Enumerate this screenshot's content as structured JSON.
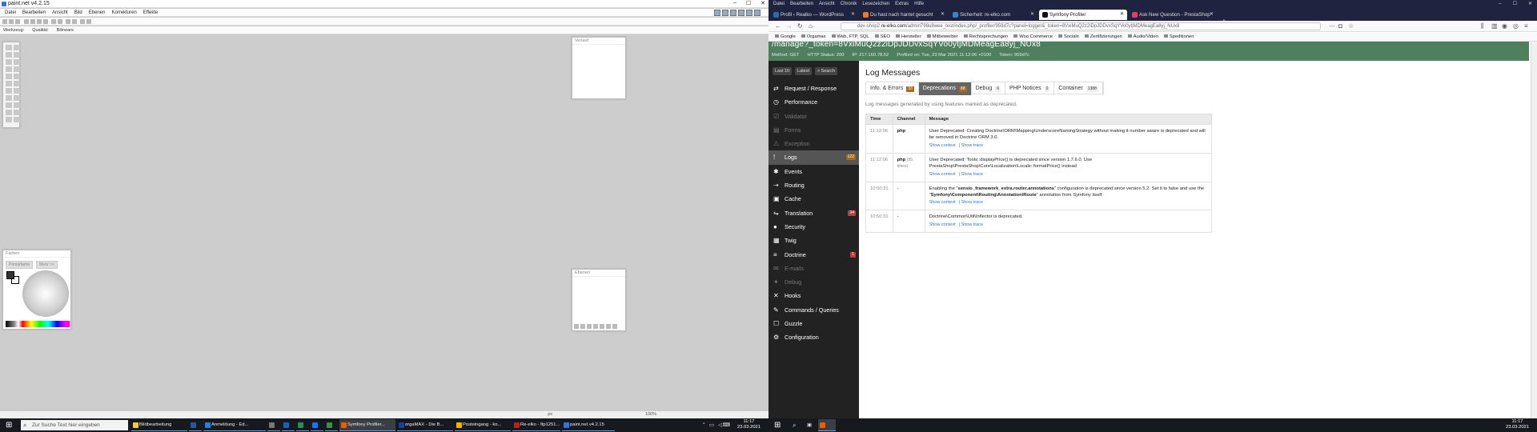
{
  "paintnet": {
    "title": "paint.net v4.2.15",
    "menu": [
      "Datei",
      "Bearbeiten",
      "Ansicht",
      "Bild",
      "Ebenen",
      "Korrekturen",
      "Effekte"
    ],
    "toolbar2": {
      "tool_label": "Werkzeug:",
      "quality_label": "Qualität:",
      "quality_value": "Bilineare"
    },
    "history_title": "Verlauf",
    "layers_title": "Ebenen",
    "colors_title": "Farben",
    "colors_primary": "Primärfarbe",
    "colors_more": "Mehr >>",
    "zoom": "100%",
    "unit": "px"
  },
  "firefox": {
    "menu": [
      "Datei",
      "Bearbeiten",
      "Ansicht",
      "Chronik",
      "Lesezeichen",
      "Extras",
      "Hilfe"
    ],
    "tabs": [
      {
        "label": "Profil ‹ Realko — WordPress",
        "color": "#2b6ca3"
      },
      {
        "label": "Du hast nach hantel gesucht",
        "color": "#e07b3a"
      },
      {
        "label": "Sicherheit: re-elko.com",
        "color": "#3b82c4"
      },
      {
        "label": "Symfony Profiler",
        "color": "#111111"
      },
      {
        "label": "Ask New Question - PrestaShop",
        "color": "#df3f6b"
      }
    ],
    "url_prefix": "dev-shop2.",
    "url_domain": "re-elko.com",
    "url_rest": "/admin798u8wee_test/index.php/_profiler/959d7c?panel=logger&_token=8VxiMuQ2z2iDpJDDvxSqYVo0ytjMDMeagEa8yj_NUx8",
    "bookmarks": [
      "Google",
      "Orgamax",
      "Web, FTP, SQL",
      "SEO",
      "Hersteller",
      "Mitbewerber",
      "Rechtsprechungen",
      "Woo Commerce",
      "Socials",
      "Zertifizierungen",
      "Audio/Video",
      "Speditionen"
    ]
  },
  "profiler": {
    "token_url": "/manage?_token=8VxiMuQ2z2iDpJDDvxSqYVo0ytjMDMeagEa8yj_NUx8",
    "meta": [
      "Method: GET",
      "HTTP Status: 200",
      "IP: 217.160.78.52",
      "Profiled on: Tue, 23 Mar 2021 11:12:06 +0100",
      "Token: 959d7c"
    ],
    "search_buttons": [
      "Last 10",
      "Latest",
      "Search"
    ],
    "sidebar": [
      {
        "label": "Request / Response",
        "icon": "⇄",
        "state": "normal"
      },
      {
        "label": "Performance",
        "icon": "◷",
        "state": "normal"
      },
      {
        "label": "Validator",
        "icon": "☑",
        "state": "dim"
      },
      {
        "label": "Forms",
        "icon": "▤",
        "state": "dim"
      },
      {
        "label": "Exception",
        "icon": "⚠",
        "state": "dim"
      },
      {
        "label": "Logs",
        "icon": "!",
        "state": "active",
        "count": "122",
        "count_color": "y"
      },
      {
        "label": "Events",
        "icon": "✱",
        "state": "normal"
      },
      {
        "label": "Routing",
        "icon": "⇢",
        "state": "normal"
      },
      {
        "label": "Cache",
        "icon": "▣",
        "state": "normal"
      },
      {
        "label": "Translation",
        "icon": "⇋",
        "state": "normal",
        "count": "34",
        "count_color": "r"
      },
      {
        "label": "Security",
        "icon": "●",
        "state": "normal"
      },
      {
        "label": "Twig",
        "icon": "▦",
        "state": "normal"
      },
      {
        "label": "Doctrine",
        "icon": "≡",
        "state": "normal",
        "count": "1",
        "count_color": "r"
      },
      {
        "label": "E-mails",
        "icon": "✉",
        "state": "dim"
      },
      {
        "label": "Debug",
        "icon": "✦",
        "state": "dim"
      },
      {
        "label": "Hooks",
        "icon": "✕",
        "state": "normal"
      },
      {
        "label": "Commands / Queries",
        "icon": "✎",
        "state": "normal"
      },
      {
        "label": "Guzzle",
        "icon": "☐",
        "state": "normal"
      },
      {
        "label": "Configuration",
        "icon": "⚙",
        "state": "normal"
      }
    ],
    "heading": "Log Messages",
    "tabs": [
      {
        "label": "Info. & Errors",
        "count": "33",
        "style": "y"
      },
      {
        "label": "Deprecations",
        "count": "88",
        "style": "active"
      },
      {
        "label": "Debug",
        "count": "6",
        "style": ""
      },
      {
        "label": "PHP Notices",
        "count": "0",
        "style": ""
      },
      {
        "label": "Container",
        "count": "1388",
        "style": ""
      }
    ],
    "helptext": "Log messages generated by using features marked as deprecated.",
    "columns": [
      "Time",
      "Channel",
      "Message"
    ],
    "show_context": "Show context",
    "show_trace": "Show trace",
    "rows": [
      {
        "time": "11:12:06",
        "channel": "php",
        "channel_extra": "",
        "message": "User Deprecated: Creating Doctrine\\ORM\\Mapping\\UnderscoreNamingStrategy without making it number aware is deprecated and will be removed in Doctrine ORM 3.0."
      },
      {
        "time": "11:12:06",
        "channel": "php",
        "channel_extra": "(85 times)",
        "message": "User Deprecated: Tools::displayPrice() is deprecated since version 1.7.6.0. Use PrestaShop\\PrestaShop\\Core\\Localization\\Locale::formatPrice() instead"
      },
      {
        "time": "10:50:31",
        "channel": "-",
        "channel_extra": "",
        "message_pre": "Enabling the \"",
        "message_b1": "sensio_framework_extra.router.annotations",
        "message_mid": "\" configuration is deprecated since version 5.2. Set it to false and use the \"",
        "message_b2": "Symfony\\Component\\Routing\\Annotation\\Route",
        "message_post": "\" annotation from Symfony itself."
      },
      {
        "time": "10:50:31",
        "channel": "-",
        "channel_extra": "",
        "message": "Doctrine\\Common\\Util\\Inflector is deprecated."
      }
    ]
  },
  "taskbar_left": {
    "search_placeholder": "Zur Suche Text hier eingeben",
    "items": [
      {
        "label": "Bildbearbeitung",
        "color": "#f2c94c"
      },
      {
        "label": "",
        "color": "#2b5797"
      },
      {
        "label": "Anmeldung - Ed...",
        "color": "#2b7cd3"
      },
      {
        "label": "",
        "color": "#777"
      },
      {
        "label": "",
        "color": "#1e5fb4"
      },
      {
        "label": "",
        "color": "#2e8b57"
      },
      {
        "label": "",
        "color": "#1a73e8"
      },
      {
        "label": "",
        "color": "#3e8e41"
      },
      {
        "label": "Symfony Profiler...",
        "color": "#e66000"
      },
      {
        "label": "orgaMAX - Die B...",
        "color": "#1b3f8f"
      },
      {
        "label": "Posteingang - ko...",
        "color": "#f0b400"
      },
      {
        "label": "Re-elko - ftp1251...",
        "color": "#b22222"
      },
      {
        "label": "paint.net v4.2.15",
        "color": "#3a6fd8"
      }
    ],
    "time": "11:17",
    "date": "23.03.2021"
  },
  "taskbar_right": {
    "time": "11:17",
    "date": "23.03.2021"
  }
}
